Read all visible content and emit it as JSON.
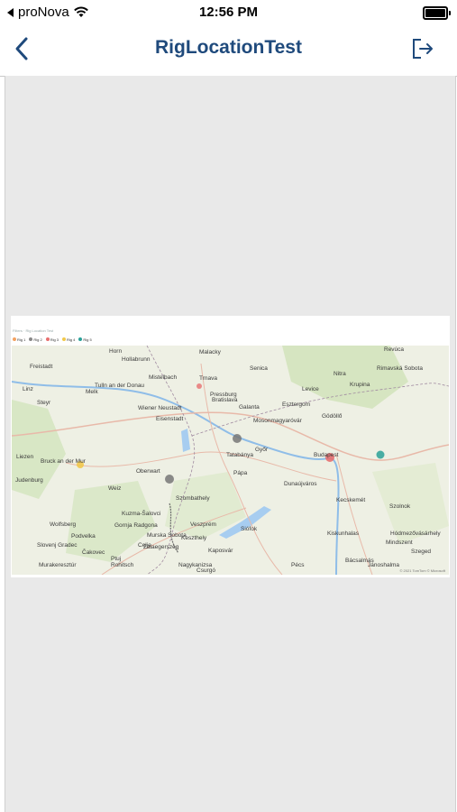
{
  "status_bar": {
    "carrier": "proNova",
    "time": "12:56 PM"
  },
  "nav": {
    "title": "RigLocationTest",
    "back_icon": "chevron-left-icon",
    "logout_icon": "logout-icon",
    "accent": "#1f4a7c"
  },
  "report": {
    "header": "Filters · Rig Location Test",
    "legend": [
      {
        "label": "Rig 1",
        "color": "#f4a261"
      },
      {
        "label": "Rig 2",
        "color": "#888888"
      },
      {
        "label": "Rig 3",
        "color": "#e76f6f"
      },
      {
        "label": "Rig 4",
        "color": "#f1c84b"
      },
      {
        "label": "Rig 5",
        "color": "#2aa198"
      }
    ],
    "map_labels": [
      "Horn",
      "Hollabrunn",
      "Malacky",
      "Revúca",
      "Freistadt",
      "Rimavská Sobota",
      "Mistelbach",
      "Senica",
      "Nitra",
      "Krupina",
      "Linz",
      "Tulln an der Donau",
      "Trnava",
      "Melk",
      "Bratislava",
      "Galanta",
      "Steyr",
      "Pressburg",
      "Eisenstadt",
      "Levice",
      "Liezen",
      "Wiener Neustadt",
      "Mosonmagyaróvár",
      "Esztergom",
      "Gödöllő",
      "Bruck an der Mur",
      "Oberwart",
      "Győr",
      "Tatabánya",
      "Budapest",
      "Judenburg",
      "Szombathely",
      "Pápa",
      "Dunaújváros",
      "Weiz",
      "Veszprém",
      "Kecskemét",
      "Wolfsberg",
      "Zalaegerszeg",
      "Siófok",
      "Szolnok",
      "Kuzma-Šalovci",
      "Gornja Radgona",
      "Murska Sobota",
      "Keszthely",
      "Kaposvár",
      "Slovenj Gradec",
      "Podvelka",
      "Ptuj",
      "Celje",
      "Čakovec",
      "Kiskunhalas",
      "Hódmezővásárhely",
      "Rohitsch",
      "Nagykanizsa",
      "Szeged",
      "Mindszent",
      "Bácsalmás",
      "Murakeresztúr",
      "Jánoshalma",
      "Csurgó",
      "Pécs"
    ],
    "attribution": "© 2021 TomTom © Microsoft"
  }
}
